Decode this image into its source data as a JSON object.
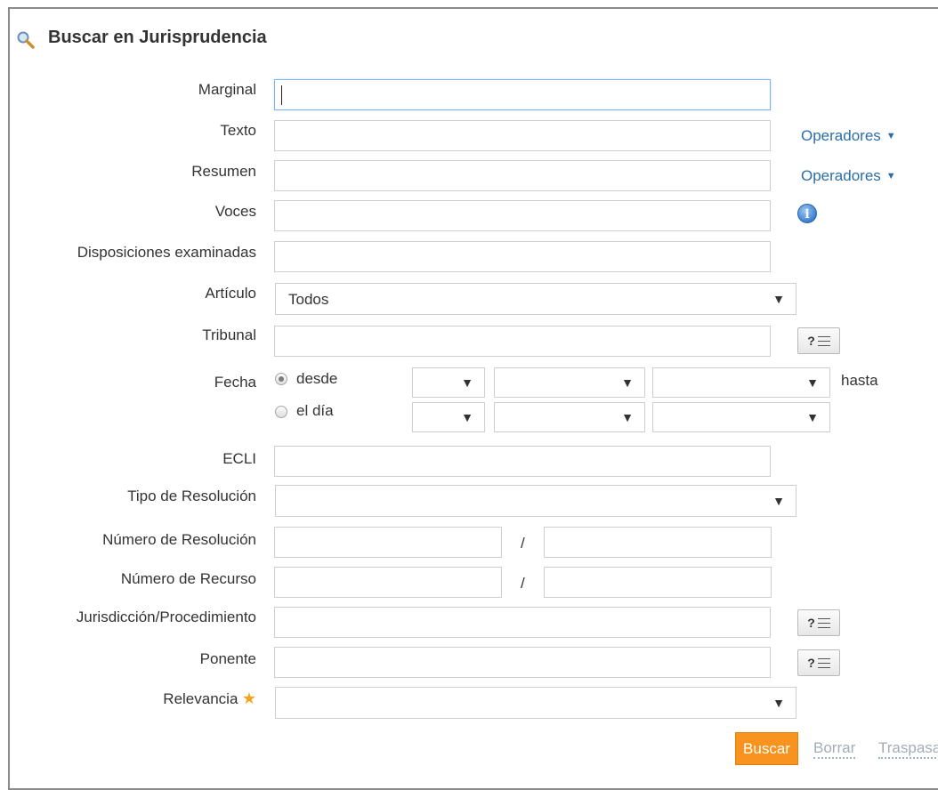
{
  "header": {
    "title": "Buscar en Jurisprudencia",
    "icon": "search-icon"
  },
  "fields": {
    "marginal": {
      "label": "Marginal",
      "value": ""
    },
    "texto": {
      "label": "Texto",
      "value": "",
      "operators_link": "Operadores"
    },
    "resumen": {
      "label": "Resumen",
      "value": "",
      "operators_link": "Operadores"
    },
    "voces": {
      "label": "Voces",
      "value": "",
      "info_icon": "info-icon"
    },
    "disposiciones": {
      "label": "Disposiciones examinadas",
      "value": ""
    },
    "articulo": {
      "label": "Artículo",
      "selected": "Todos"
    },
    "tribunal": {
      "label": "Tribunal",
      "value": "",
      "help_label": "?"
    },
    "fecha": {
      "label": "Fecha",
      "option_desde": "desde",
      "option_el_dia": "el día",
      "selected_option": "desde",
      "hasta_label": "hasta"
    },
    "ecli": {
      "label": "ECLI",
      "value": ""
    },
    "tipo_resolucion": {
      "label": "Tipo de Resolución",
      "selected": ""
    },
    "numero_resolucion": {
      "label": "Número de Resolución",
      "separator": "/"
    },
    "numero_recurso": {
      "label": "Número de Recurso",
      "separator": "/"
    },
    "jurisdiccion": {
      "label": "Jurisdicción/Procedimiento",
      "value": "",
      "help_label": "?"
    },
    "ponente": {
      "label": "Ponente",
      "value": "",
      "help_label": "?"
    },
    "relevancia": {
      "label": "Relevancia",
      "selected": "",
      "icon": "star-icon"
    }
  },
  "actions": {
    "search": "Buscar",
    "clear": "Borrar",
    "transfer": "Traspasar"
  },
  "colors": {
    "accent": "#f7931e",
    "link": "#2a6ea8",
    "focus_border": "#7fb2e5"
  }
}
